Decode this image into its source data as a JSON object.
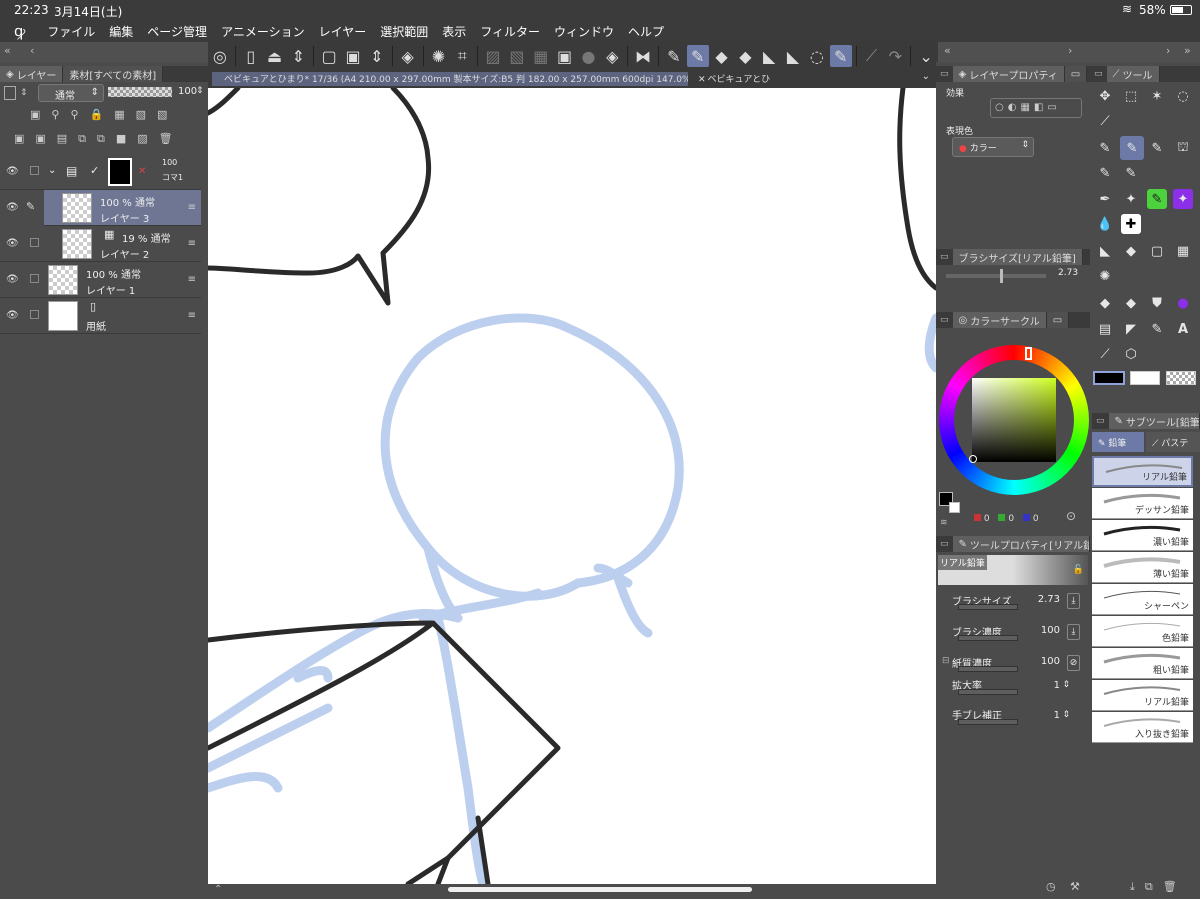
{
  "status": {
    "time": "22:23",
    "date": "3月14日(土)",
    "battery": "58%"
  },
  "menu": [
    "ファイル",
    "編集",
    "ページ管理",
    "アニメーション",
    "レイヤー",
    "選択範囲",
    "表示",
    "フィルター",
    "ウィンドウ",
    "ヘルプ"
  ],
  "document_tab": {
    "title": "ベビキュアとひまり* 17/36 (A4 210.00 x 297.00mm 製本サイズ:B5 判 182.00 x 257.00mm 600dpi 147.0%)",
    "second": "ベビキュアとひ"
  },
  "layer_panel": {
    "tab_layer": "レイヤー",
    "tab_material": "素材[すべての素材]",
    "blend_mode": "通常",
    "opacity": "100",
    "layers": [
      {
        "pct": "100",
        "name": "コマ1"
      },
      {
        "pct": "100 % 通常",
        "name": "レイヤー 3"
      },
      {
        "pct": "19 % 通常",
        "name": "レイヤー 2"
      },
      {
        "pct": "100 % 通常",
        "name": "レイヤー 1"
      },
      {
        "pct": "",
        "name": "用紙"
      }
    ]
  },
  "layer_property": {
    "title": "レイヤープロパティ",
    "effect_label": "効果",
    "color_label": "表現色",
    "color_value": "カラー"
  },
  "brush_size_panel": {
    "title": "ブラシサイズ[リアル鉛筆]",
    "value": "2.73"
  },
  "color_circle": {
    "title": "カラーサークル",
    "r": "0",
    "g": "0",
    "b": "0",
    "main_color": "#000000",
    "sub_color": "#ffffff"
  },
  "tool_property": {
    "title": "ツールプロパティ[リアル鉛",
    "preset": "リアル鉛筆",
    "rows": [
      {
        "label": "ブラシサイズ",
        "value": "2.73"
      },
      {
        "label": "ブラシ濃度",
        "value": "100"
      },
      {
        "label": "紙質濃度",
        "value": "100"
      },
      {
        "label": "拡大率",
        "value": "1"
      },
      {
        "label": "手ブレ補正",
        "value": "1"
      }
    ]
  },
  "tool_panel": {
    "title": "ツール"
  },
  "subtool_panel": {
    "title": "サブツール[鉛筆",
    "tab1": "鉛筆",
    "tab2": "パステ",
    "items": [
      "リアル鉛筆",
      "デッサン鉛筆",
      "濃い鉛筆",
      "薄い鉛筆",
      "シャーペン",
      "色鉛筆",
      "粗い鉛筆",
      "リアル鉛筆",
      "入り抜き鉛筆"
    ]
  }
}
